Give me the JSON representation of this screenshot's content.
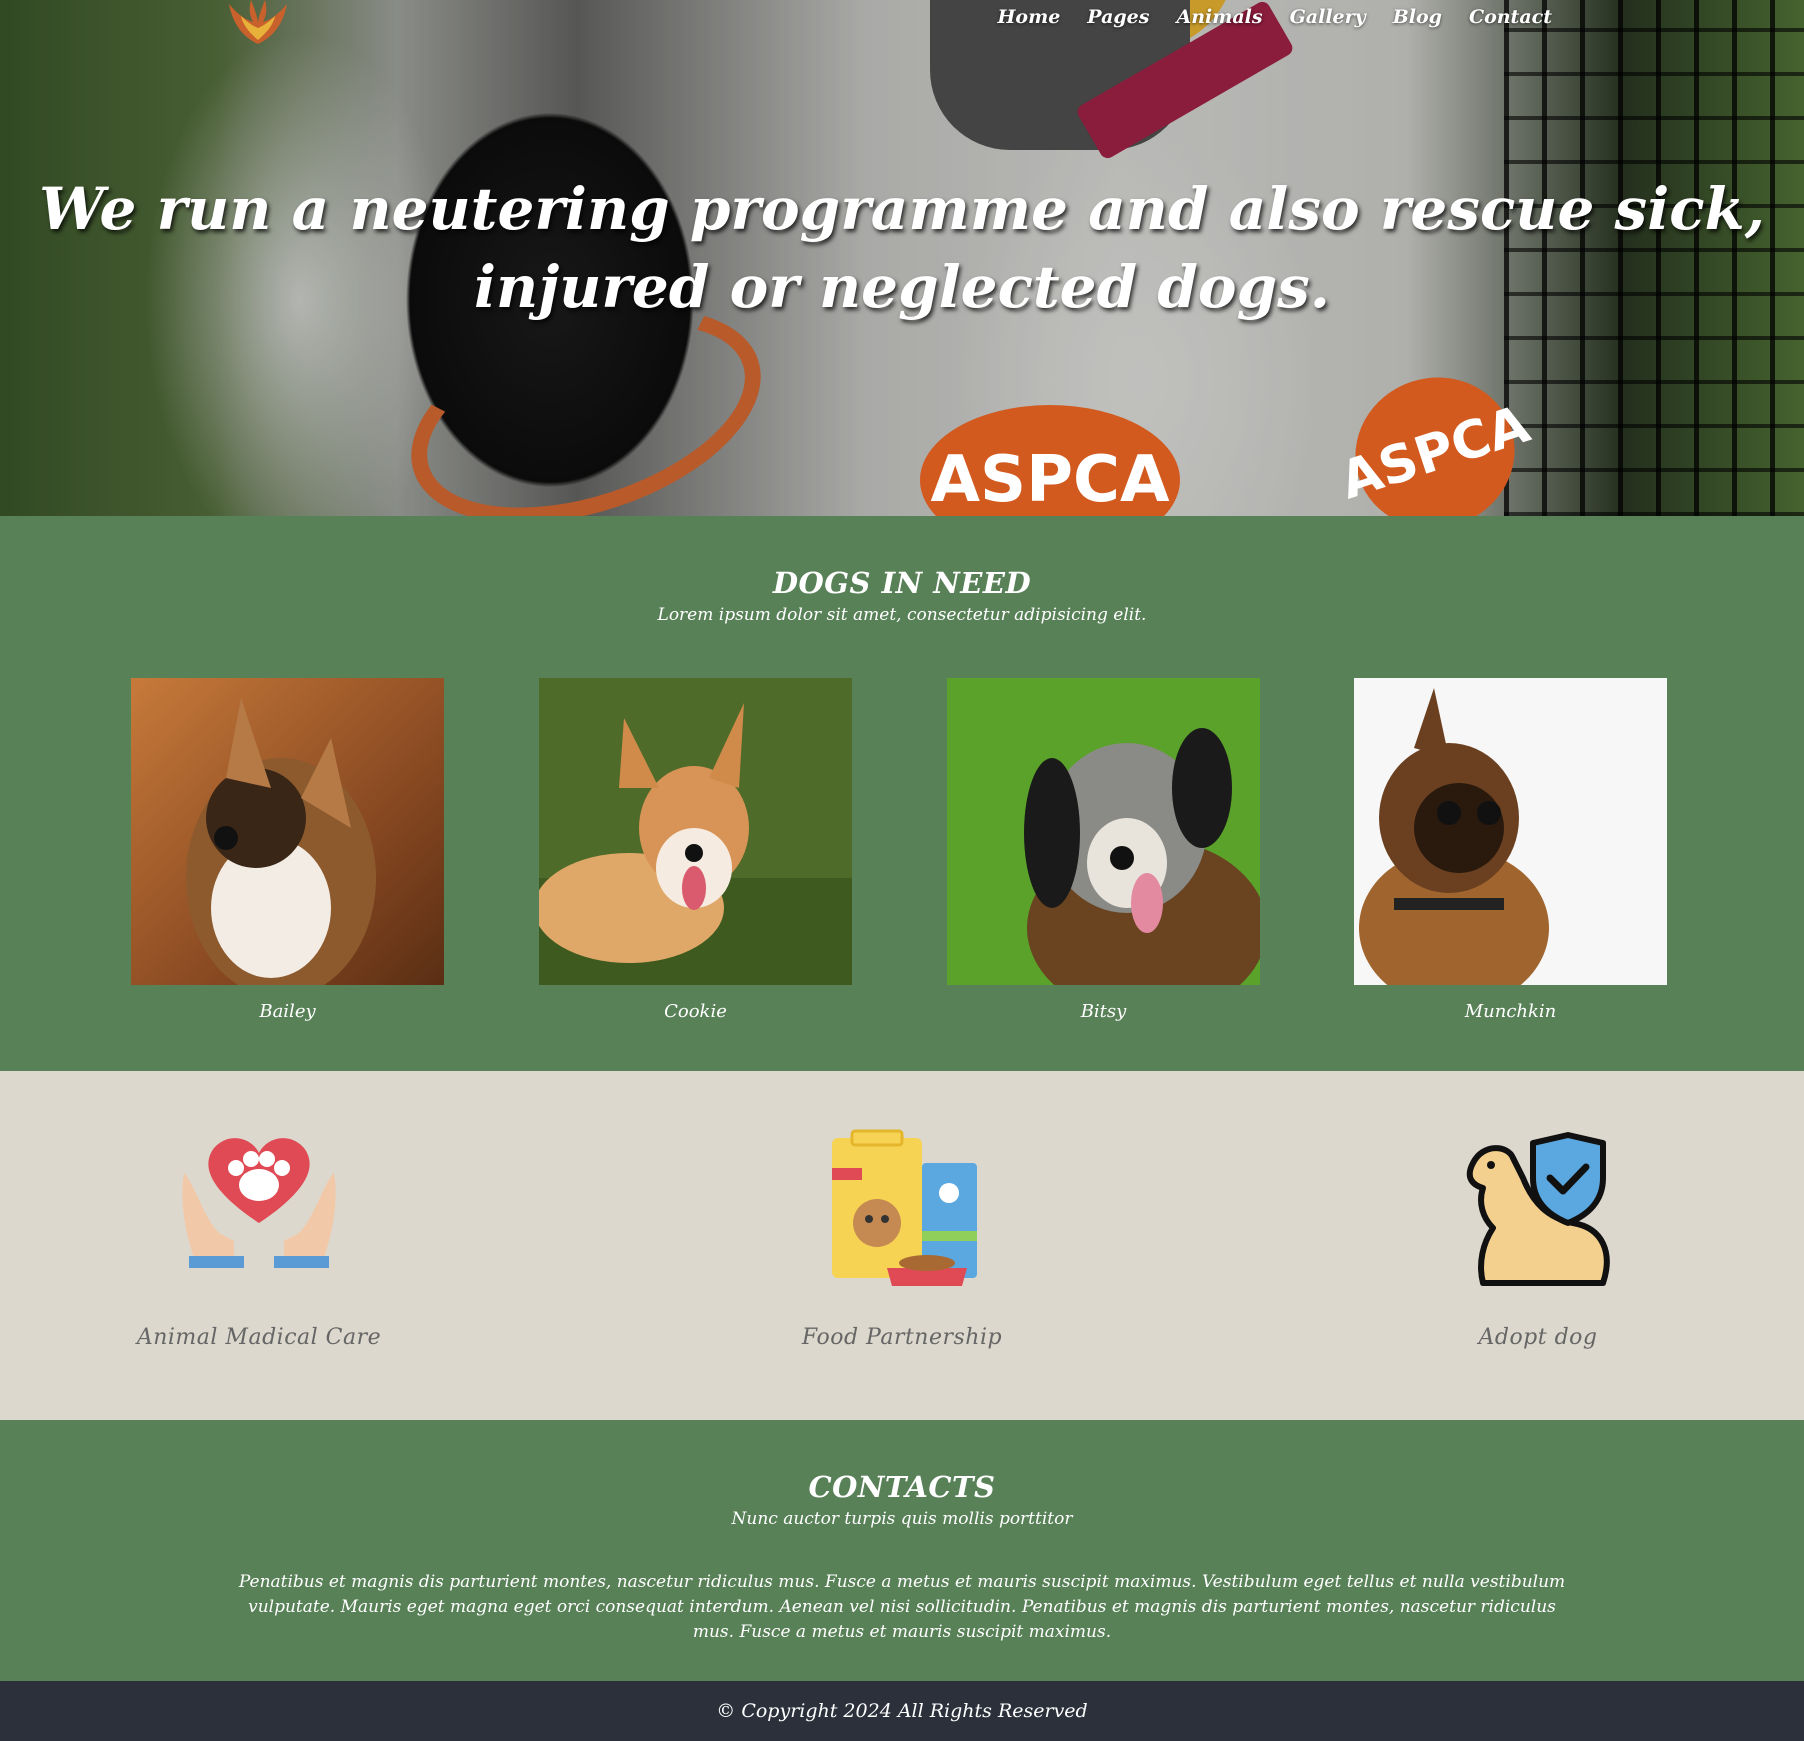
{
  "nav": {
    "items": [
      "Home",
      "Pages",
      "Animals",
      "Gallery",
      "Blog",
      "Contact"
    ]
  },
  "hero": {
    "title": "We run a neutering programme and also rescue sick, injured or neglected dogs.",
    "patch_text": "ASPCA"
  },
  "dogs_section": {
    "title": "DOGS IN NEED",
    "subtitle": "Lorem ipsum dolor sit amet, consectetur adipisicing elit.",
    "dogs": [
      {
        "name": "Bailey"
      },
      {
        "name": "Cookie"
      },
      {
        "name": "Bitsy"
      },
      {
        "name": "Munchkin"
      }
    ]
  },
  "services": {
    "items": [
      {
        "label": "Animal Madical Care",
        "icon": "heart-paw-hands-icon"
      },
      {
        "label": "Food Partnership",
        "icon": "pet-food-icon"
      },
      {
        "label": "Adopt dog",
        "icon": "dog-shield-icon"
      }
    ]
  },
  "contacts": {
    "title": "CONTACTS",
    "subtitle": "Nunc auctor turpis quis mollis porttitor",
    "text": "Penatibus et magnis dis parturient montes, nascetur ridiculus mus. Fusce a metus et mauris suscipit maximus. Vestibulum eget tellus et nulla vestibulum vulputate. Mauris eget magna eget orci consequat interdum. Aenean vel nisi sollicitudin. Penatibus et magnis dis parturient montes, nascetur ridiculus mus. Fusce a metus et mauris suscipit maximus."
  },
  "footer": {
    "copyright": "© Copyright 2024 All Rights Reserved"
  },
  "colors": {
    "green": "#588158",
    "beige": "#dcd8cd",
    "footer": "#2b303b"
  }
}
